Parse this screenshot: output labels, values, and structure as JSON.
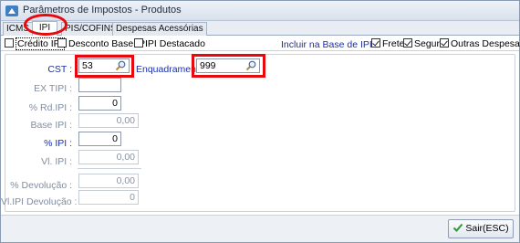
{
  "window": {
    "title": "Parâmetros de Impostos - Produtos"
  },
  "tabs": [
    {
      "label": "ICMS"
    },
    {
      "label": "IPI"
    },
    {
      "label": "PIS/COFINS"
    },
    {
      "label": "Despesas Acessórias"
    }
  ],
  "options": {
    "credito_ipi": {
      "label": "Crédito IPI",
      "checked": false
    },
    "desconto_base_ipi": {
      "label": "Desconto Base IPI",
      "checked": false
    },
    "ipi_destacado": {
      "label": "IPI Destacado",
      "checked": false
    },
    "incluir_label": "Incluir na Base de IPI :",
    "frete": {
      "label": "Frete",
      "checked": true
    },
    "seguro": {
      "label": "Seguro",
      "checked": true
    },
    "outras_despesas": {
      "label": "Outras Despesas",
      "checked": true
    }
  },
  "fields": {
    "cst": {
      "label": "CST :",
      "value": "53"
    },
    "enquadramento": {
      "label": "Enquadramento",
      "value": "999"
    },
    "ex_tipi": {
      "label": "EX TIPI :",
      "value": ""
    },
    "perc_rd_ipi": {
      "label": "% Rd.IPI :",
      "value": "0"
    },
    "base_ipi": {
      "label": "Base IPI :",
      "value": "0,00"
    },
    "perc_ipi": {
      "label": "% IPI :",
      "value": "0"
    },
    "vl_ipi": {
      "label": "Vl. IPI :",
      "value": "0,00"
    },
    "perc_devolucao": {
      "label": "% Devolução :",
      "value": "0,00"
    },
    "vl_ipi_devolucao": {
      "label": "Vl.IPI Devolução :",
      "value": "0"
    }
  },
  "footer": {
    "sair_label": "Sair(ESC)"
  },
  "colors": {
    "highlight": "#e8090f",
    "label_blue": "#1a2ea8",
    "label_gray": "#7f8ea3"
  },
  "icons": [
    "app-icon",
    "search-icon",
    "check-icon"
  ]
}
